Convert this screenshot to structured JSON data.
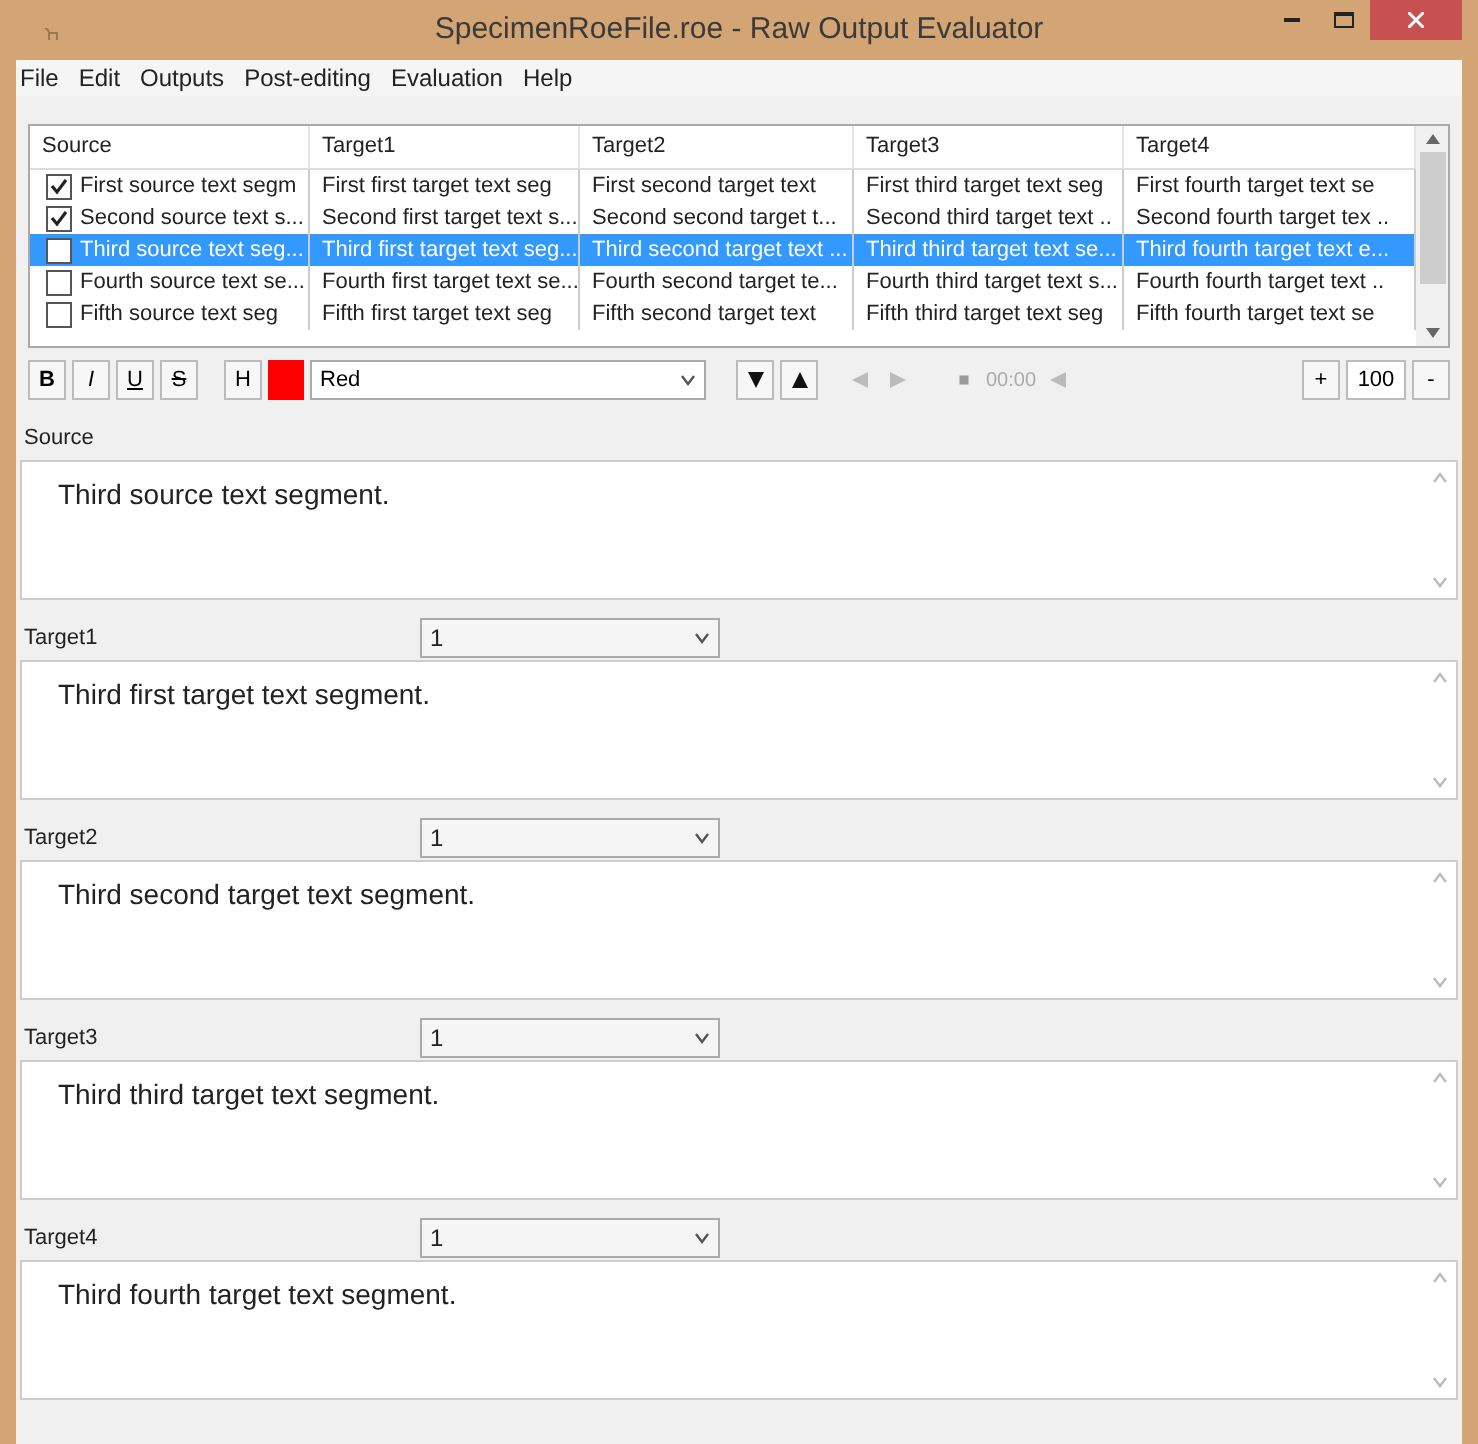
{
  "window": {
    "title": "SpecimenRoeFile.roe - Raw Output Evaluator"
  },
  "menu": [
    "File",
    "Edit",
    "Outputs",
    "Post-editing",
    "Evaluation",
    "Help"
  ],
  "grid": {
    "columns": [
      "Source",
      "Target1",
      "Target2",
      "Target3",
      "Target4"
    ],
    "rows": [
      {
        "checked": true,
        "selected": false,
        "cells": [
          "First source text segm",
          "First first target text seg",
          "First second target text",
          "First third target text seg",
          "First fourth target text se"
        ]
      },
      {
        "checked": true,
        "selected": false,
        "cells": [
          "Second source text s...",
          "Second first target text s...",
          "Second second target t...",
          "Second third target text ..",
          "Second fourth target tex .."
        ]
      },
      {
        "checked": false,
        "selected": true,
        "cells": [
          "Third source text seg...",
          "Third first target text seg...",
          "Third second target text ...",
          "Third third target text se...",
          "Third fourth target text e..."
        ]
      },
      {
        "checked": false,
        "selected": false,
        "cells": [
          "Fourth source text se...",
          "Fourth first target text se...",
          "Fourth second target te...",
          "Fourth third target text s...",
          "Fourth fourth target text .."
        ]
      },
      {
        "checked": false,
        "selected": false,
        "cells": [
          "Fifth source text seg",
          "Fifth first target text seg",
          "Fifth second target text",
          "Fifth third target text seg",
          "Fifth fourth target text se"
        ]
      }
    ]
  },
  "toolbar": {
    "format_buttons": [
      "B",
      "I",
      "U",
      "S"
    ],
    "highlight": {
      "label": "H",
      "color": "#ff0000"
    },
    "color_name": "Red",
    "time": "00:00",
    "zoom": "100",
    "zoom_in": "+",
    "zoom_out": "-"
  },
  "panels": [
    {
      "label": "Source",
      "text": "Third source text segment."
    },
    {
      "label": "Target1",
      "rank": "1",
      "text": "Third first target text segment."
    },
    {
      "label": "Target2",
      "rank": "1",
      "text": "Third second target text segment."
    },
    {
      "label": "Target3",
      "rank": "1",
      "text": "Third third target text segment."
    },
    {
      "label": "Target4",
      "rank": "1",
      "text": "Third fourth target text segment."
    }
  ]
}
